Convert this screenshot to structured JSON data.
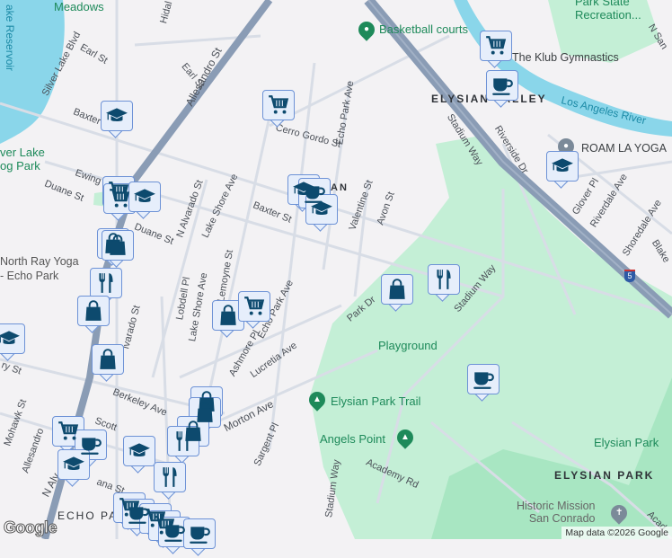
{
  "map": {
    "colors": {
      "land": "#f3f2f4",
      "park": "#c4efd6",
      "water": "#8ad6ea",
      "freeway": "#8a9cb5",
      "road": "#d8dde6",
      "marker_fill": "#e6eefb",
      "marker_border": "#6d92d6",
      "icon": "#0d4a6e",
      "poi_green": "#1e8a5a"
    },
    "labels": {
      "meadows": "Meadows",
      "reservoir": "ake Reservoir",
      "silver_lake_blvd": "Silver Lake Blvd",
      "earl_st_1": "Earl St",
      "earl_st_2": "Earl St",
      "hidalgo": "Hidal",
      "allesandro_st": "Allesandro St",
      "baxter_1": "Baxter",
      "cerro_gordo": "Cerro Gordo St",
      "echo_park_ave_top": "Echo Park Ave",
      "silver_lake_dog_park": "ver Lake\nog Park",
      "ewing_st": "Ewing St",
      "duane_st_1": "Duane St",
      "duane_st_2": "Duane St",
      "n_alvarado": "N Alvarado St",
      "lake_shore_ave": "Lake Shore Ave",
      "baxter_st": "Baxter St",
      "valentine_st": "Valentine St",
      "avon_st": "Avon St",
      "an_s": "AN\nS",
      "north_ray_yoga": "North Ray Yoga\n- Echo Park",
      "lobdell_pl": "Lobdell Pl",
      "lake_shore_ave_2": "Lake Shore Ave",
      "lemoyne_st": "Lemoyne St",
      "echo_park_ave": "Echo Park Ave",
      "ashmore_pl": "Ashmore Pl",
      "lucretia_ave": "Lucretia Ave",
      "park_dr": "Park Dr",
      "alvarado_st": "lvarado St",
      "berkeley_ave": "Berkeley Ave",
      "morton_ave": "Morton Ave",
      "mohawk_st": "Mohawk St",
      "allesandro_2": "Allesandro",
      "scott": "Scott",
      "sargent_pl": "Sargent Pl",
      "echo_park": "ECHO PA",
      "n_alv": "N Alv",
      "ry_st": "ry St",
      "ana_st": "ana St",
      "basketball_courts": "Basketball courts",
      "klub_gymnastics": "The Klub Gymnastics",
      "park_state_rec": "Park State\nRecreation...",
      "n_san": "N San",
      "elysian_valley": "ELYSIAN VALLEY",
      "la_river": "Los Angeles River",
      "stadium_way_1": "Stadium Way",
      "riverside_dr": "Riverside Dr",
      "roam_la_yoga": "ROAM LA YOGA",
      "glover_pl": "Glover Pl",
      "riverdale_ave": "Riverdale Ave",
      "shoredale_ave": "Shoredale Ave",
      "blake": "Blake",
      "stadium_way_2": "Stadium Way",
      "playground": "Playground",
      "elysian_park_trail": "Elysian Park Trail",
      "angels_point": "Angels Point",
      "academy_rd": "Academy Rd",
      "stadium_way_3": "Stadium Way",
      "elysian_park_poi": "Elysian Park",
      "elysian_park_hood": "ELYSIAN PARK",
      "historic_mission": "Historic Mission\nSan Conrado",
      "acad": "Acad",
      "i5_shield": "5"
    },
    "markers": [
      "grad-cap-icon",
      "shopping-cart-icon",
      "shopping-cart-icon",
      "coffee-cup-icon",
      "grad-cap-icon",
      "grad-cap-icon",
      "coffee-cup-icon",
      "grad-cap-icon",
      "shopping-cart-icon",
      "shopping-cart-icon",
      "grad-cap-icon",
      "shopping-bag-icon",
      "shopping-bag-icon",
      "fork-knife-icon",
      "shopping-bag-icon",
      "grad-cap-icon",
      "shopping-bag-icon",
      "shopping-bag-icon",
      "shopping-cart-icon",
      "shopping-bag-icon",
      "fork-knife-icon",
      "coffee-cup-icon",
      "shopping-bag-icon",
      "shopping-bag-icon",
      "shopping-cart-icon",
      "coffee-cup-icon",
      "grad-cap-icon",
      "shopping-bag-icon",
      "grad-cap-icon",
      "fork-knife-icon",
      "fork-knife-icon",
      "shopping-cart-icon",
      "coffee-cup-icon",
      "shopping-cart-icon",
      "shopping-cart-icon",
      "coffee-cup-icon",
      "coffee-cup-icon"
    ],
    "attribution": "Map data ©2026 Google",
    "logo": "Google"
  }
}
